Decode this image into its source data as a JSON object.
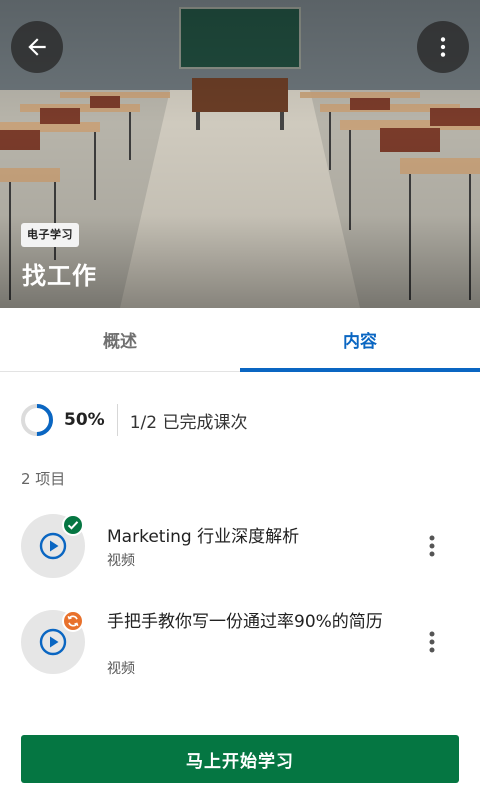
{
  "hero": {
    "badge": "电子学习",
    "title": "找工作"
  },
  "icons": {
    "back": "arrow-left-icon",
    "more": "more-vertical-icon",
    "play": "play-circle-icon",
    "completed": "checkmark-icon",
    "in_progress": "sync-icon"
  },
  "tabs": [
    {
      "label": "概述",
      "active": false
    },
    {
      "label": "内容",
      "active": true
    }
  ],
  "progress": {
    "percent_label": "50%",
    "percent_value": 0.5,
    "completed_text": "1/2 已完成课次"
  },
  "items_count": "2 项目",
  "items": [
    {
      "title": "Marketing 行业深度解析",
      "type": "视频",
      "status": "completed"
    },
    {
      "title": "手把手教你写一份通过率90%的简历",
      "type": "视频",
      "status": "in-progress"
    }
  ],
  "start_button": "马上开始学习",
  "colors": {
    "accent_blue": "#0a66c2",
    "primary_green": "#057642",
    "completed_green": "#057642",
    "in_progress_orange": "#e8712c"
  }
}
